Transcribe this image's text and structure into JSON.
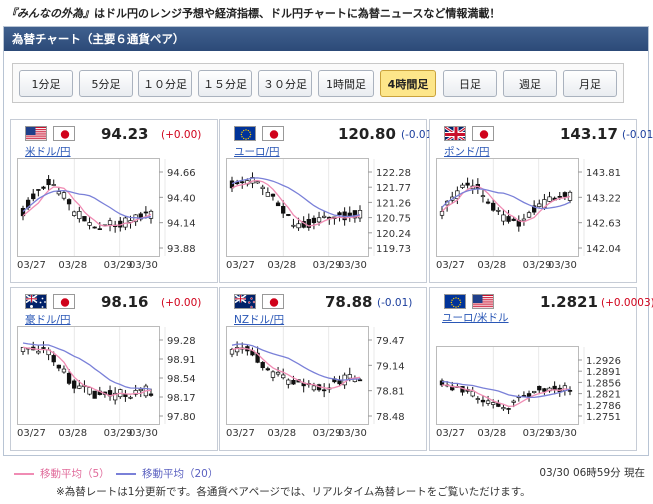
{
  "headline": {
    "name": "『みんなの外為』",
    "text": "はドル円のレンジ予想や経済指標、ドル円チャートに為替ニュースなど情報満載！"
  },
  "panel": {
    "title": "為替チャート（主要６通貨ペア）"
  },
  "periods": [
    {
      "label": "1分足",
      "active": false
    },
    {
      "label": "5分足",
      "active": false
    },
    {
      "label": "１０分足",
      "active": false
    },
    {
      "label": "１５分足",
      "active": false
    },
    {
      "label": "３０分足",
      "active": false
    },
    {
      "label": "1時間足",
      "active": false
    },
    {
      "label": "4時間足",
      "active": true
    },
    {
      "label": "日足",
      "active": false
    },
    {
      "label": "週足",
      "active": false
    },
    {
      "label": "月足",
      "active": false
    }
  ],
  "colors": {
    "ma5": "#f08cb4",
    "ma20": "#7a80d8",
    "up_text": "#d0021b",
    "down_text": "#1a3d9c",
    "accent": "#2c4a78"
  },
  "cards": [
    {
      "pair": "米ドル/円",
      "flags": [
        "us-flag-icon",
        "jp-flag-icon"
      ],
      "rate": "94.23",
      "change": "(+0.00)",
      "up": true,
      "yticks": [
        "94.66",
        "94.40",
        "94.14",
        "93.88"
      ],
      "xticks": [
        "03/27",
        "03/28",
        "03/29",
        "03/30"
      ]
    },
    {
      "pair": "ユーロ/円",
      "flags": [
        "eu-flag-icon",
        "jp-flag-icon"
      ],
      "rate": "120.80",
      "change": "(-0.01)",
      "up": false,
      "yticks": [
        "122.28",
        "121.77",
        "121.26",
        "120.75",
        "120.24",
        "119.73"
      ],
      "xticks": [
        "03/27",
        "03/28",
        "03/29",
        "03/30"
      ]
    },
    {
      "pair": "ポンド/円",
      "flags": [
        "uk-flag-icon",
        "jp-flag-icon"
      ],
      "rate": "143.17",
      "change": "(-0.01)",
      "up": false,
      "yticks": [
        "143.81",
        "143.22",
        "142.63",
        "142.04"
      ],
      "xticks": [
        "03/27",
        "03/28",
        "03/29",
        "03/30"
      ]
    },
    {
      "pair": "豪ドル/円",
      "flags": [
        "au-flag-icon",
        "jp-flag-icon"
      ],
      "rate": "98.16",
      "change": "(+0.00)",
      "up": true,
      "yticks": [
        "99.28",
        "98.91",
        "98.54",
        "98.17",
        "97.80"
      ],
      "xticks": [
        "03/27",
        "03/28",
        "03/29",
        "03/30"
      ]
    },
    {
      "pair": "NZドル/円",
      "flags": [
        "nz-flag-icon",
        "jp-flag-icon"
      ],
      "rate": "78.88",
      "change": "(-0.01)",
      "up": false,
      "yticks": [
        "79.47",
        "79.14",
        "78.81",
        "78.48"
      ],
      "xticks": [
        "03/27",
        "03/28",
        "03/29",
        "03/30"
      ]
    },
    {
      "pair": "ユーロ/米ドル",
      "flags": [
        "eu-flag-icon",
        "us-flag-icon"
      ],
      "rate": "1.2821",
      "change": "(+0.0003)",
      "up": true,
      "yticks": [
        "1.2926",
        "1.2891",
        "1.2856",
        "1.2821",
        "1.2786",
        "1.2751"
      ],
      "xticks": [
        "03/27",
        "03/28",
        "03/29",
        "03/30"
      ]
    }
  ],
  "legend": {
    "ma5": "移動平均（5）",
    "ma20": "移動平均（20）"
  },
  "timestamp": "03/30 06時59分 現在",
  "note": "※為替レートは1分更新です。各通貨ペアページでは、リアルタイム為替レートをご覧いただけます。"
}
